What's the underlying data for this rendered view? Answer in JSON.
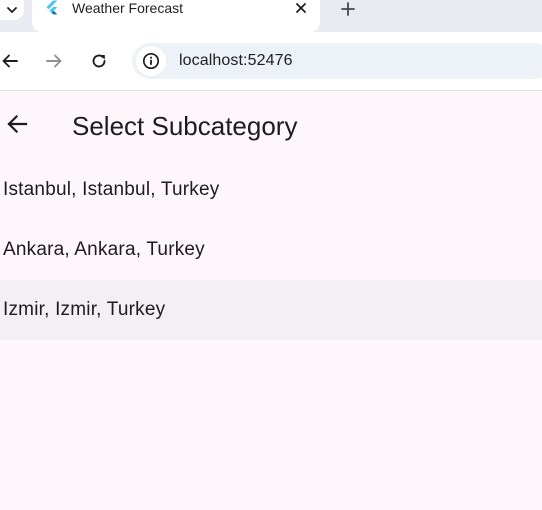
{
  "browser": {
    "tab": {
      "title": "Weather Forecast",
      "favicon": "flutter-logo-icon",
      "close_icon": "close-icon"
    },
    "new_tab_icon": "plus-icon",
    "tab_menu_icon": "chevron-down-icon",
    "nav": {
      "back_icon": "arrow-left-icon",
      "forward_icon": "arrow-right-icon",
      "reload_icon": "reload-icon"
    },
    "address": {
      "url": "localhost:52476",
      "site_info_icon": "info-icon"
    }
  },
  "app": {
    "appbar": {
      "title": "Select Subcategory",
      "back_icon": "arrow-left-icon"
    },
    "subcategories": [
      {
        "label": "Istanbul, Istanbul, Turkey",
        "highlighted": false
      },
      {
        "label": "Ankara, Ankara, Turkey",
        "highlighted": false
      },
      {
        "label": "Izmir, Izmir, Turkey",
        "highlighted": true
      }
    ]
  },
  "colors": {
    "app_background": "#fdf7fb",
    "highlight_row": "#f3eff3",
    "tabstrip": "#e8ebf2",
    "omnibox": "#edf1f8",
    "flutter_blue": "#47c5fb",
    "flutter_dark_blue": "#0175c2"
  }
}
